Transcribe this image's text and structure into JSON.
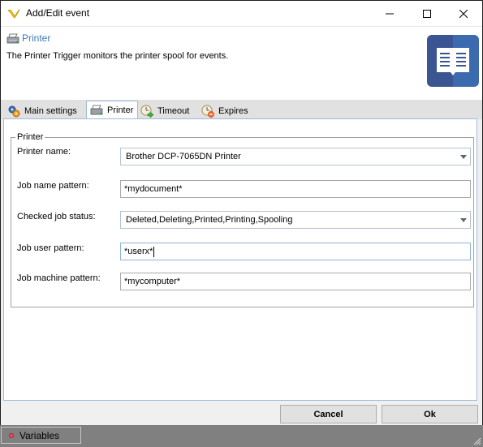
{
  "window": {
    "title": "Add/Edit event",
    "controls": {
      "minimize": "minimize",
      "maximize": "maximize",
      "close": "close"
    }
  },
  "header": {
    "title": "Printer",
    "description": "The Printer Trigger monitors the printer spool for events.",
    "icon": "printer-icon",
    "logo": "book-icon",
    "colors": {
      "title": "#3d7ab8",
      "logo_left": "#3a5591",
      "logo_right": "#3b6aae"
    }
  },
  "tabs": [
    {
      "label": "Main settings",
      "icon": "gears-icon",
      "active": false
    },
    {
      "label": "Printer",
      "icon": "printer-icon",
      "active": true
    },
    {
      "label": "Timeout",
      "icon": "clock-arrow-icon",
      "active": false
    },
    {
      "label": "Expires",
      "icon": "clock-stop-icon",
      "active": false
    }
  ],
  "printer_group": {
    "legend": "Printer",
    "fields": {
      "printer_name": {
        "label": "Printer name:",
        "value": "Brother DCP-7065DN Printer",
        "type": "dropdown"
      },
      "job_name_pattern": {
        "label": "Job name pattern:",
        "value": "*mydocument*",
        "type": "text"
      },
      "checked_job_status": {
        "label": "Checked job status:",
        "value": "Deleted,Deleting,Printed,Printing,Spooling",
        "type": "dropdown"
      },
      "job_user_pattern": {
        "label": "Job user pattern:",
        "value": "*userx*",
        "type": "text",
        "focused": true
      },
      "job_machine_pattern": {
        "label": "Job machine pattern:",
        "value": "*mycomputer*",
        "type": "text"
      }
    }
  },
  "buttons": {
    "cancel": "Cancel",
    "ok": "Ok"
  },
  "statusbar": {
    "variables_label": "Variables"
  }
}
